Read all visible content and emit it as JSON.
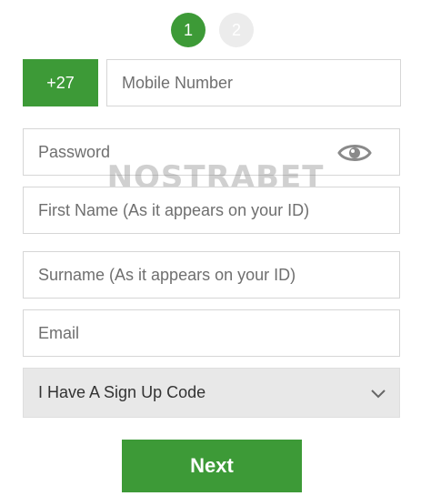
{
  "steps": {
    "current_label": "1",
    "next_label": "2"
  },
  "form": {
    "country_code": "+27",
    "mobile_placeholder": "Mobile Number",
    "password_placeholder": "Password",
    "first_name_placeholder": "First Name (As it appears on your ID)",
    "surname_placeholder": "Surname (As it appears on your ID)",
    "email_placeholder": "Email",
    "signup_code_label": "I Have A Sign Up Code",
    "next_label": "Next"
  },
  "watermark": "NOSTRABET",
  "icons": {
    "password_toggle": "eye-icon",
    "signup_expand": "chevron-down-icon"
  },
  "colors": {
    "brand_green": "#3d9a37",
    "inactive_step": "#ececec",
    "select_bg": "#e8e8e8"
  }
}
